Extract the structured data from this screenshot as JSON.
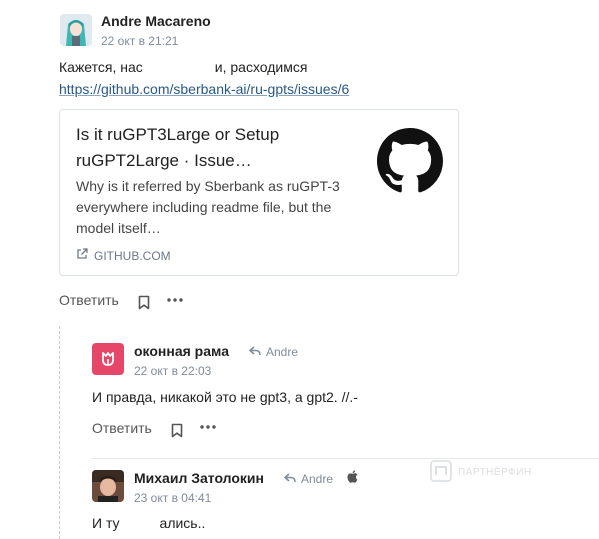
{
  "post": {
    "author": "Andre Macareno",
    "date": "22 окт в 21:21",
    "text_before": "Кажется, нас",
    "text_after": "и, расходимся",
    "link": "https://github.com/sberbank-ai/ru-gpts/issues/6",
    "card": {
      "title": "Is it ruGPT3Large or Setup ruGPT2Large · Issue…",
      "description": "Why is it referred by Sberbank as ruGPT-3 everywhere including readme file, but the model itself…",
      "source": "GITHUB.COM",
      "logo_icon": "github-icon"
    },
    "reply_label": "Ответить"
  },
  "replies": [
    {
      "author": "оконная рама",
      "reply_to": "Andre",
      "date": "22 окт в 22:03",
      "text": "И правда, никакой это не gpt3, а gpt2. //.-",
      "reply_label": "Ответить",
      "avatar_color": "#e64667"
    },
    {
      "author": "Михаил Затолокин",
      "reply_to": "Andre",
      "date": "23 окт в 04:41",
      "text_before": "И ту",
      "text_after": "ались..",
      "device_icon": "apple-icon"
    }
  ],
  "watermark": "ПАРТНЁРФИН"
}
